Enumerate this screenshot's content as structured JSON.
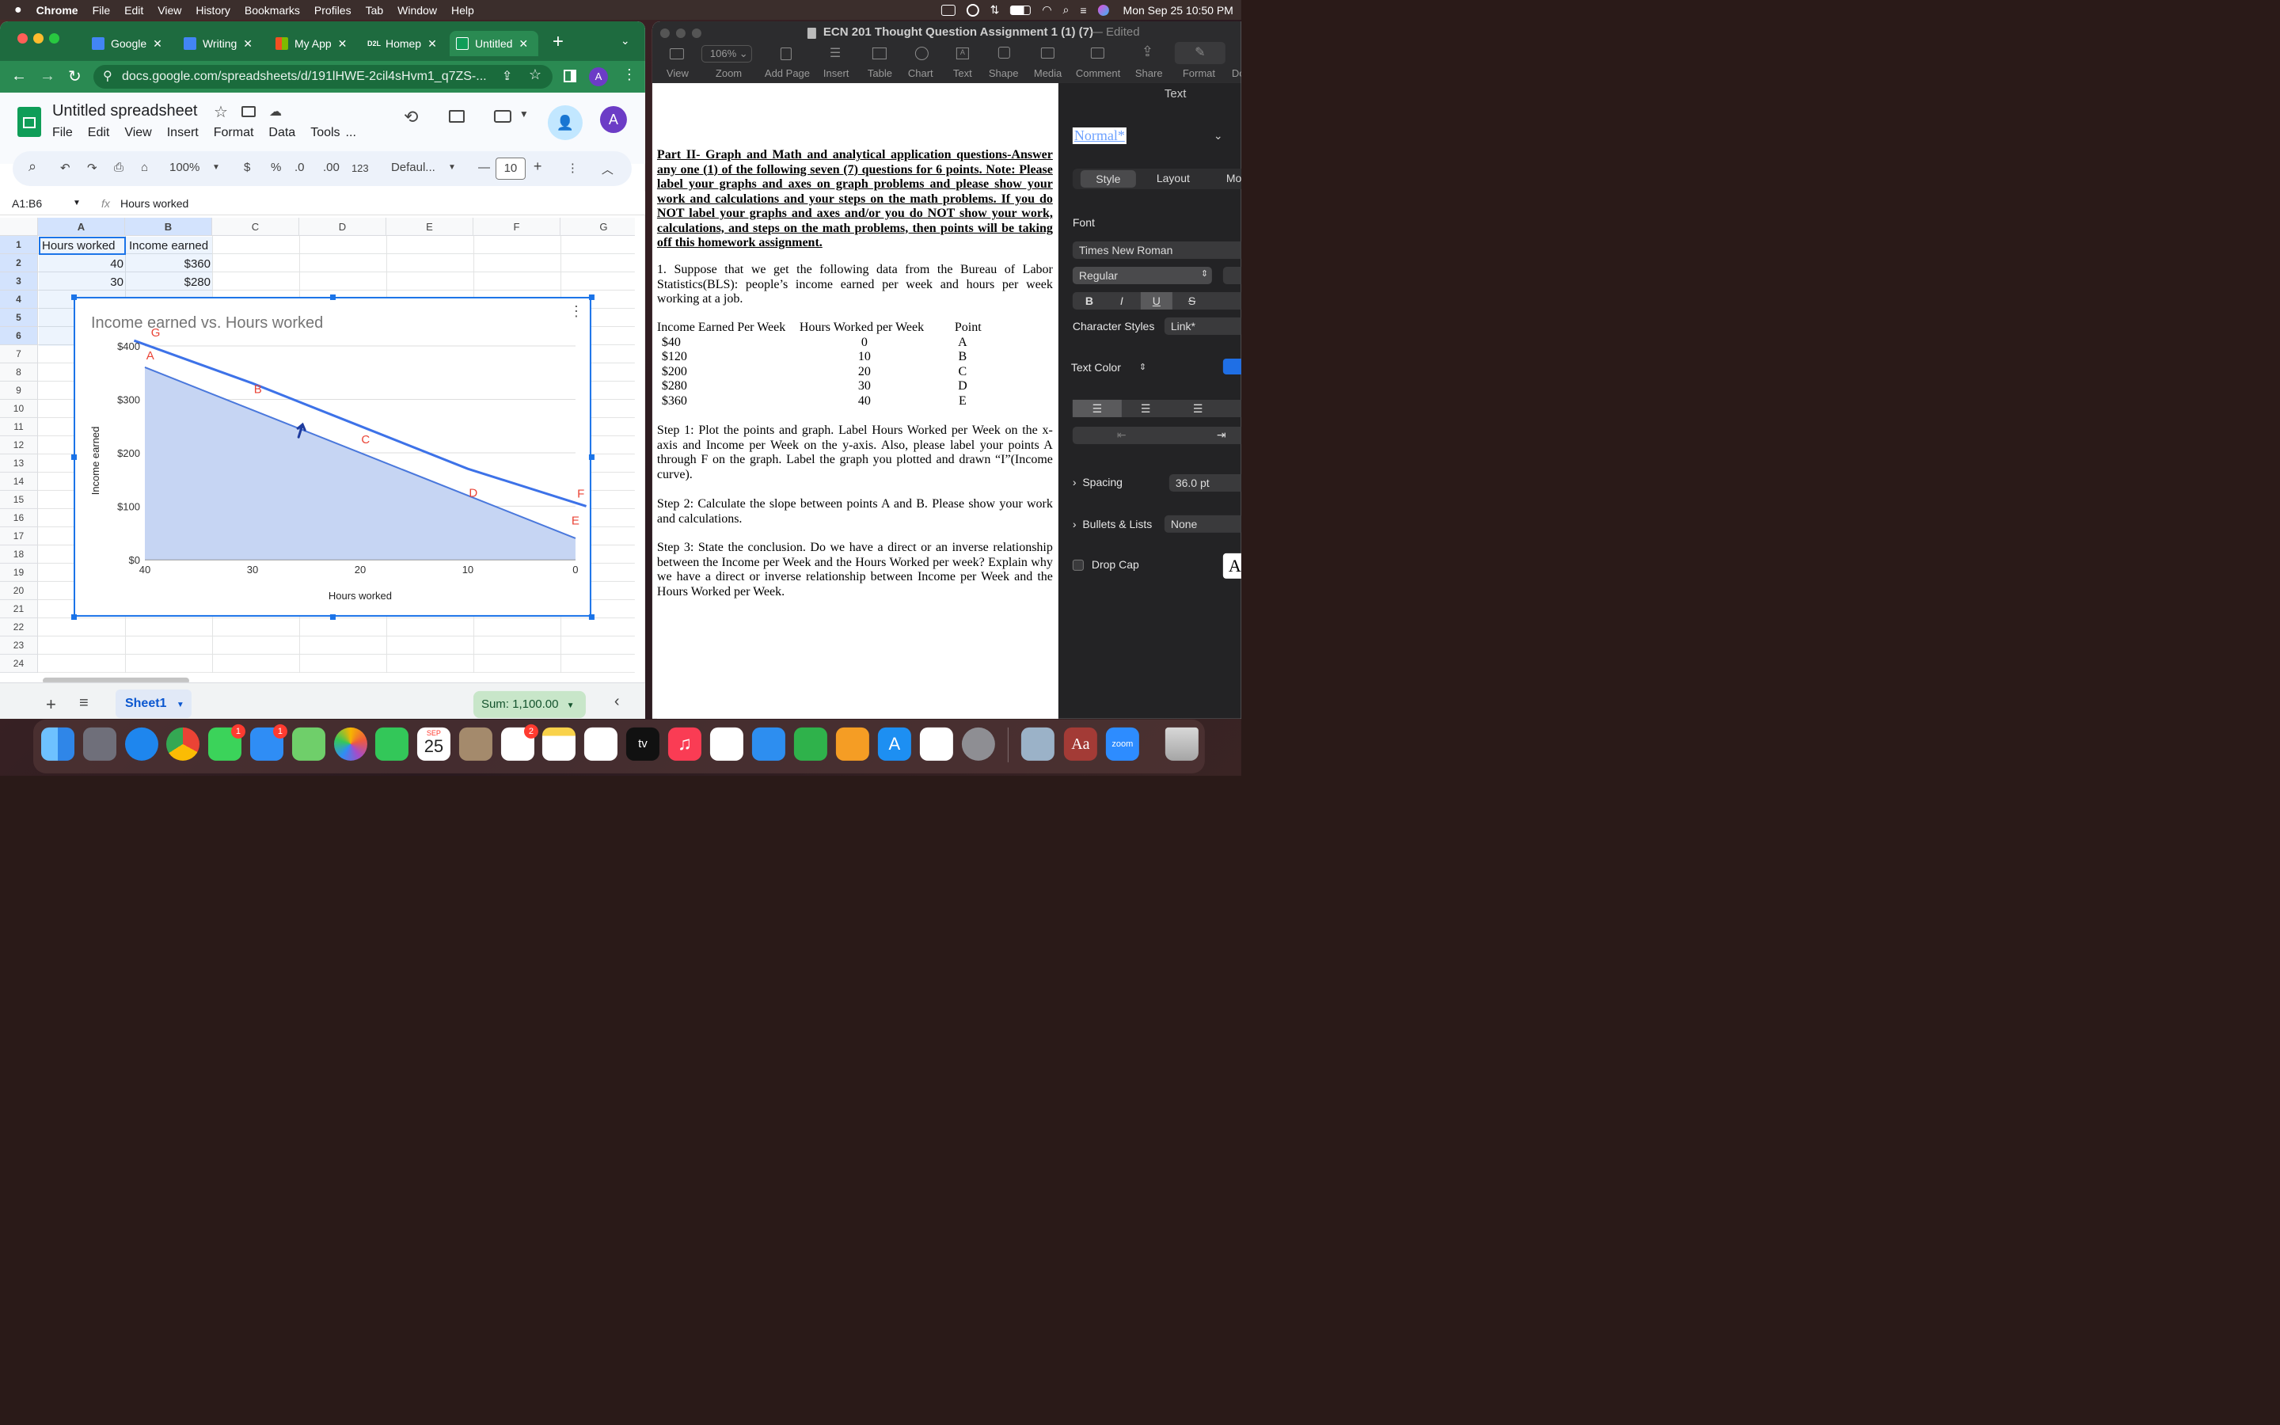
{
  "menubar": {
    "apple": "",
    "items": [
      "Chrome",
      "File",
      "Edit",
      "View",
      "History",
      "Bookmarks",
      "Profiles",
      "Tab",
      "Window",
      "Help"
    ],
    "clock": "Mon Sep 25  10:50 PM"
  },
  "chrome": {
    "tabs": [
      {
        "label": "Google",
        "icon_color": "#4285f4"
      },
      {
        "label": "Writing",
        "icon_color": "#4285f4"
      },
      {
        "label": "My App",
        "icon_color": "#f25022"
      },
      {
        "label": "Homep",
        "icon_color": "#222222",
        "prefix": "D2L"
      },
      {
        "label": "Untitled",
        "icon_color": "#0f9d58"
      }
    ],
    "new_tab": "+",
    "url": "docs.google.com/spreadsheets/d/191lHWE-2cil4sHvm1_q7ZS-...",
    "profile_letter": "A"
  },
  "sheets": {
    "title": "Untitled spreadsheet",
    "menus": [
      "File",
      "Edit",
      "View",
      "Insert",
      "Format",
      "Data",
      "Tools",
      "..."
    ],
    "avatar": "A",
    "zoom": "100%",
    "currency": "$",
    "percent": "%",
    "dec_less": ".0",
    "dec_more": ".00",
    "num_fmt": "123",
    "font": "Defaul...",
    "font_size": "10",
    "name_box": "A1:B6",
    "formula": "Hours worked",
    "fx": "fx",
    "columns": [
      "A",
      "B",
      "C",
      "D",
      "E",
      "F",
      "G"
    ],
    "rows": [
      "1",
      "2",
      "3",
      "4",
      "5",
      "6",
      "7",
      "8",
      "9",
      "10",
      "11",
      "12",
      "13",
      "14",
      "15",
      "16",
      "17",
      "18",
      "19",
      "20",
      "21",
      "22",
      "23",
      "24"
    ],
    "cells": {
      "a1": "Hours worked",
      "b1": "Income earned",
      "a2": "40",
      "b2": "$360",
      "a3": "30",
      "b3": "$280"
    },
    "sheet_tab": "Sheet1",
    "sum": "Sum: 1,100.00",
    "add_sheet": "+"
  },
  "chart_data": {
    "type": "area",
    "title": "Income earned  vs. Hours worked",
    "xlabel": "Hours worked",
    "ylabel": "Income earned",
    "x": [
      40,
      30,
      20,
      10,
      0
    ],
    "x_reversed": true,
    "xlim": [
      40,
      0
    ],
    "ylim": [
      0,
      400
    ],
    "x_ticks": [
      "40",
      "30",
      "20",
      "10",
      "0"
    ],
    "y_ticks": [
      "$0",
      "$100",
      "$200",
      "$300",
      "$400"
    ],
    "y_tick_values": [
      0,
      100,
      200,
      300,
      400
    ],
    "series": [
      {
        "values": [
          360,
          280,
          200,
          120,
          40
        ],
        "fill": "#c6d5f3",
        "color": "#4a78dc"
      },
      {
        "values": [
          410,
          330,
          250,
          170,
          100
        ],
        "color": "#3d72e8",
        "x": [
          41,
          30,
          20,
          10,
          -1
        ]
      }
    ],
    "point_labels": [
      {
        "text": "G",
        "x": 39,
        "y": 418
      },
      {
        "text": "A",
        "x": 39.5,
        "y": 375
      },
      {
        "text": "B",
        "x": 29.5,
        "y": 312
      },
      {
        "text": "C",
        "x": 19.5,
        "y": 218
      },
      {
        "text": "D",
        "x": 9.5,
        "y": 118
      },
      {
        "text": "E",
        "x": 0,
        "y": 66
      },
      {
        "text": "F",
        "x": -0.5,
        "y": 116
      }
    ],
    "label_color": "#ea4335",
    "grid": true,
    "annotation_arrow": {
      "x": 25.5,
      "y": 250
    }
  },
  "pages": {
    "title": "ECN 201 Thought Question Assignment 1 (1) (7)",
    "edited": "— Edited",
    "zoom": "106%",
    "toolbar": [
      "View",
      "Zoom",
      "Add Page",
      "Insert",
      "Table",
      "Chart",
      "Text",
      "Shape",
      "Media",
      "Comment",
      "Share",
      "Format",
      "Do"
    ],
    "part2": "Part II- Graph and Math and analytical application questions-Answer any one (1) of the following seven (7) questions for 6 points.   Note: Please label your graphs and axes on graph problems and please show your work and calculations and your steps on the math problems. If you do NOT label your graphs and axes and/or you do NOT show your work, calculations, and steps on the math problems, then points will be taking off this homework assignment.",
    "q1": "1. Suppose that we get the following data from the Bureau of Labor Statistics(BLS): people’s income earned per week and hours per week working at a job.",
    "table_headers": [
      "Income Earned Per Week",
      "Hours Worked per Week",
      "Point"
    ],
    "table_rows": [
      [
        "$40",
        "0",
        "A"
      ],
      [
        "$120",
        "10",
        "B"
      ],
      [
        "$200",
        "20",
        "C"
      ],
      [
        "$280",
        "30",
        "D"
      ],
      [
        "$360",
        "40",
        "E"
      ]
    ],
    "step1": "Step 1: Plot the points and graph. Label Hours Worked per Week on the x-axis and Income per Week on the y-axis. Also, please label your points A through F on the graph.  Label the graph you plotted and drawn “I”(Income curve).",
    "step2": "Step 2: Calculate the slope between points A and B. Please show your work and calculations.",
    "step3": "Step 3: State the conclusion. Do we have a direct or an inverse relationship between the Income per Week and the Hours Worked per week? Explain why we have a direct or inverse relationship between Income per Week and the Hours Worked per Week."
  },
  "inspector": {
    "header": "Text",
    "para_style": "Normal*",
    "tabs": [
      "Style",
      "Layout",
      "Mo"
    ],
    "font_label": "Font",
    "font": "Times New Roman",
    "weight": "Regular",
    "bold": "B",
    "italic": "I",
    "underline": "U",
    "strike": "S",
    "char_styles_label": "Character Styles",
    "char_style": "Link*",
    "text_color_label": "Text Color",
    "text_color": "#1f6fe5",
    "spacing_label": "Spacing",
    "spacing": "36.0 pt",
    "bullets_label": "Bullets & Lists",
    "bullets": "None",
    "dropcap_label": "Drop Cap"
  },
  "dock": {
    "calendar_month": "SEP",
    "calendar_day": "25",
    "badge_messages": "1",
    "badge_mail": "1",
    "badge_reminders": "2",
    "tv_label": "tv",
    "dict_label": "Aa",
    "zoom_label": "zoom"
  }
}
